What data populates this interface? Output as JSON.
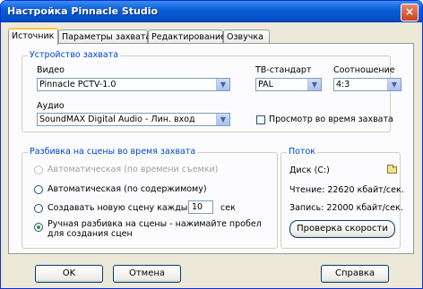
{
  "window": {
    "title": "Настройка Pinnacle Studio",
    "close_label": "×"
  },
  "tabs": [
    {
      "label": "Источник"
    },
    {
      "label": "Параметры захвата"
    },
    {
      "label": "Редактирование"
    },
    {
      "label": "Озвучка"
    }
  ],
  "capture_device": {
    "group_label": "Устройство захвата",
    "video_label": "Видео",
    "video_value": "Pinnacle PCTV-1.0",
    "audio_label": "Аудио",
    "audio_value": "SoundMAX Digital Audio - Лин. вход",
    "tv_standard_label": "ТВ-стандарт",
    "tv_standard_value": "PAL",
    "aspect_label": "Соотношение",
    "aspect_value": "4:3",
    "preview_label": "Просмотр во время захвата"
  },
  "scene_split": {
    "group_label": "Разбивка на сцены во время захвата",
    "opt_auto_time": "Автоматическая (по времени съемки)",
    "opt_auto_content": "Автоматическая (по содержимому)",
    "opt_every_prefix": "Создавать новую сцену каждые",
    "opt_every_value": "10",
    "opt_every_unit": "сек",
    "opt_manual": "Ручная разбивка на сцены - нажимайте пробел для создания сцен"
  },
  "stream": {
    "group_label": "Поток",
    "disk_label": "Диск (C:)",
    "read_label": "Чтение: 22620 кбайт/сек.",
    "write_label": "Запись: 22000 кбайт/сек.",
    "test_button": "Проверка скорости"
  },
  "buttons": {
    "ok": "OK",
    "cancel": "Отмена",
    "help": "Справка"
  }
}
